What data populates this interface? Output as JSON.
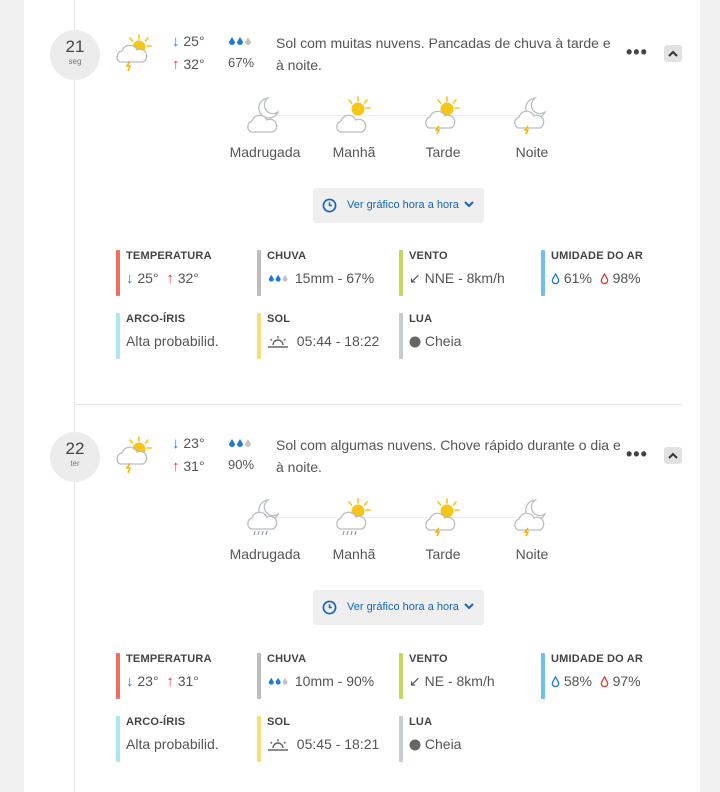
{
  "colors": {
    "down": "#1e7ad6",
    "up": "#e53935",
    "link": "#1565c0",
    "temp_bar": "#f26d60",
    "rain_bar": "#bdbdbd",
    "wind_bar": "#c5d65a",
    "humidity_bar": "#6ec1ee",
    "rainbow_bar": "#a8e8ef",
    "sun_bar": "#f6dd75",
    "moon_bar": "#c7ccd0"
  },
  "days": [
    {
      "day": "21",
      "weekday": "seg",
      "main_icon": "sun-cloud-storm-icon",
      "temp_min": "25°",
      "temp_max": "32°",
      "rain_prob": "67%",
      "description": "Sol com muitas nuvens. Pancadas de chuva à tarde e à noite.",
      "more": "•••",
      "periods": [
        {
          "label": "Madrugada",
          "icon": "moon-cloud-icon"
        },
        {
          "label": "Manhã",
          "icon": "sun-cloud-icon"
        },
        {
          "label": "Tarde",
          "icon": "sun-cloud-storm-icon"
        },
        {
          "label": "Noite",
          "icon": "moon-cloud-storm-icon"
        }
      ],
      "hourly_label": "Ver gráfico hora a hora",
      "stats": {
        "temperatura": {
          "title": "TEMPERATURA",
          "min": "25°",
          "max": "32°"
        },
        "chuva": {
          "title": "CHUVA",
          "value": "15mm - 67%"
        },
        "vento": {
          "title": "VENTO",
          "value": "NNE - 8km/h",
          "arrow": "↙"
        },
        "umidade": {
          "title": "UMIDADE DO AR",
          "min": "61%",
          "max": "98%"
        },
        "arco": {
          "title": "ARCO-ÍRIS",
          "value": "Alta probabilid."
        },
        "sol": {
          "title": "SOL",
          "value": "05:44 - 18:22"
        },
        "lua": {
          "title": "LUA",
          "value": "Cheia"
        }
      }
    },
    {
      "day": "22",
      "weekday": "ter",
      "main_icon": "sun-cloud-storm-icon",
      "temp_min": "23°",
      "temp_max": "31°",
      "rain_prob": "90%",
      "description": "Sol com algumas nuvens. Chove rápido durante o dia e à noite.",
      "more": "•••",
      "periods": [
        {
          "label": "Madrugada",
          "icon": "moon-cloud-rain-icon"
        },
        {
          "label": "Manhã",
          "icon": "sun-cloud-rain-icon"
        },
        {
          "label": "Tarde",
          "icon": "sun-cloud-storm-icon"
        },
        {
          "label": "Noite",
          "icon": "moon-cloud-storm-icon"
        }
      ],
      "hourly_label": "Ver gráfico hora a hora",
      "stats": {
        "temperatura": {
          "title": "TEMPERATURA",
          "min": "23°",
          "max": "31°"
        },
        "chuva": {
          "title": "CHUVA",
          "value": "10mm - 90%"
        },
        "vento": {
          "title": "VENTO",
          "value": "NE - 8km/h",
          "arrow": "↙"
        },
        "umidade": {
          "title": "UMIDADE DO AR",
          "min": "58%",
          "max": "97%"
        },
        "arco": {
          "title": "ARCO-ÍRIS",
          "value": "Alta probabilid."
        },
        "sol": {
          "title": "SOL",
          "value": "05:45 - 18:21"
        },
        "lua": {
          "title": "LUA",
          "value": "Cheia"
        }
      }
    }
  ]
}
